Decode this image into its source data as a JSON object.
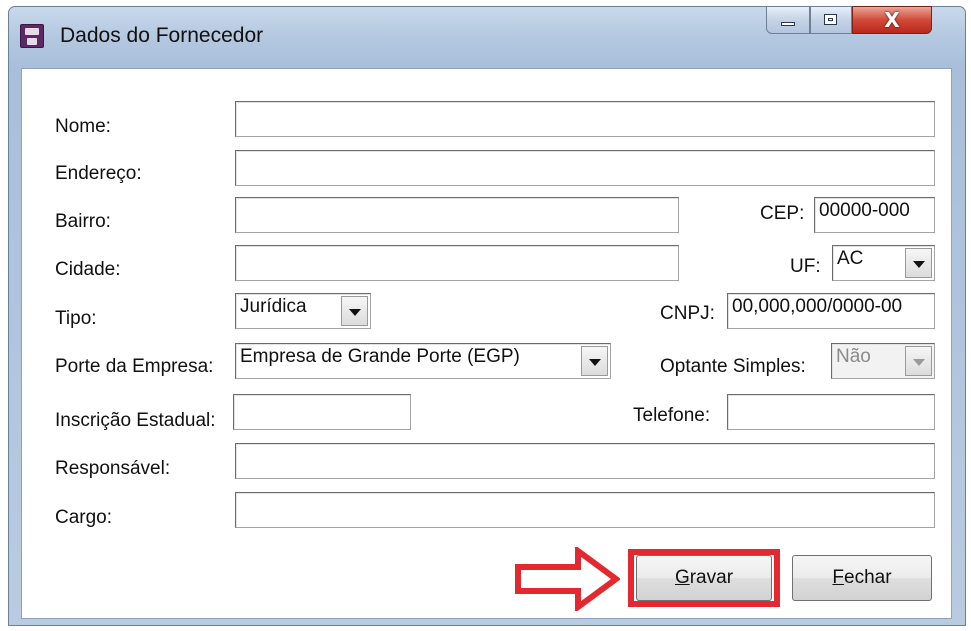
{
  "window": {
    "title": "Dados do Fornecedor",
    "icon": "save-disk-icon",
    "close_glyph": "X"
  },
  "form": {
    "nome": {
      "label": "Nome:",
      "value": ""
    },
    "endereco": {
      "label": "Endereço:",
      "value": ""
    },
    "bairro": {
      "label": "Bairro:",
      "value": ""
    },
    "cep": {
      "label": "CEP:",
      "value": "00000-000"
    },
    "cidade": {
      "label": "Cidade:",
      "value": ""
    },
    "uf": {
      "label": "UF:",
      "value": "AC"
    },
    "tipo": {
      "label": "Tipo:",
      "value": "Jurídica"
    },
    "cnpj": {
      "label": "CNPJ:",
      "value": "00,000,000/0000-00"
    },
    "porte": {
      "label": "Porte da Empresa:",
      "value": "Empresa de Grande Porte (EGP)"
    },
    "optante": {
      "label": "Optante Simples:",
      "value": "Não",
      "disabled": true
    },
    "inscricao": {
      "label": "Inscrição Estadual:",
      "value": ""
    },
    "telefone": {
      "label": "Telefone:",
      "value": ""
    },
    "responsavel": {
      "label": "Responsável:",
      "value": ""
    },
    "cargo": {
      "label": "Cargo:",
      "value": ""
    }
  },
  "buttons": {
    "gravar": {
      "mnemonic": "G",
      "rest": "ravar"
    },
    "fechar": {
      "mnemonic": "F",
      "rest": "echar"
    }
  },
  "annotation": {
    "highlight_color": "#e3282f",
    "target": "gravar"
  }
}
